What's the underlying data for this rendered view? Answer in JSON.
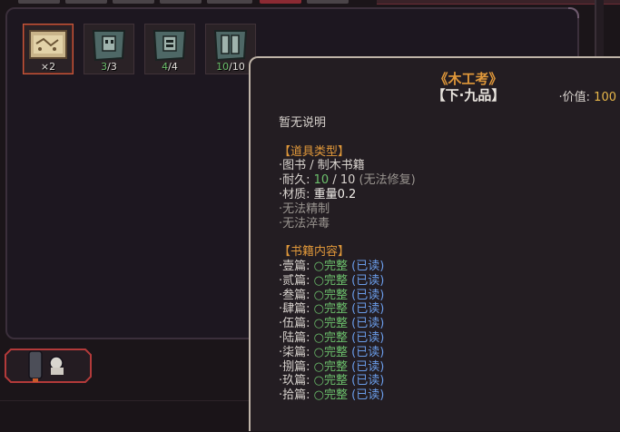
{
  "inventory": {
    "slots": [
      {
        "icon": "scroll-map-icon",
        "count_prefix": "×",
        "count_value": "2",
        "count_max": ""
      },
      {
        "icon": "book-tome-icon",
        "count_prefix": "",
        "count_value": "3",
        "count_max": "/3"
      },
      {
        "icon": "book-tome-icon",
        "count_prefix": "",
        "count_value": "4",
        "count_max": "/4"
      },
      {
        "icon": "book-tome-icon",
        "count_prefix": "",
        "count_value": "10",
        "count_max": "/10"
      }
    ]
  },
  "tooltip": {
    "title": "《木工考》",
    "grade": "【下·九品】",
    "value_label": "·价值:",
    "value_amount": "100",
    "description": "暂无说明",
    "item_type_header": "【道具类型】",
    "category": "·图书 / 制木书籍",
    "durability_label": "·耐久:",
    "durability_current": "10",
    "durability_rest": "/ 10",
    "durability_note": "(无法修复)",
    "material_label": "·材质:",
    "material_value": "重量0.2",
    "no_refine": "·无法精制",
    "no_temper": "·无法淬毒",
    "contents_header": "【书籍内容】",
    "chapters": [
      {
        "name": "·壹篇:",
        "status": "○完整",
        "read": "(已读)"
      },
      {
        "name": "·贰篇:",
        "status": "○完整",
        "read": "(已读)"
      },
      {
        "name": "·叁篇:",
        "status": "○完整",
        "read": "(已读)"
      },
      {
        "name": "·肆篇:",
        "status": "○完整",
        "read": "(已读)"
      },
      {
        "name": "·伍篇:",
        "status": "○完整",
        "read": "(已读)"
      },
      {
        "name": "·陆篇:",
        "status": "○完整",
        "read": "(已读)"
      },
      {
        "name": "·柒篇:",
        "status": "○完整",
        "read": "(已读)"
      },
      {
        "name": "·捌篇:",
        "status": "○完整",
        "read": "(已读)"
      },
      {
        "name": "·玖篇:",
        "status": "○完整",
        "read": "(已读)"
      },
      {
        "name": "·拾篇:",
        "status": "○完整",
        "read": "(已读)"
      }
    ]
  },
  "colors": {
    "accent_orange": "#e0983a",
    "status_green": "#6cc06c",
    "read_blue": "#6a9ce8"
  }
}
